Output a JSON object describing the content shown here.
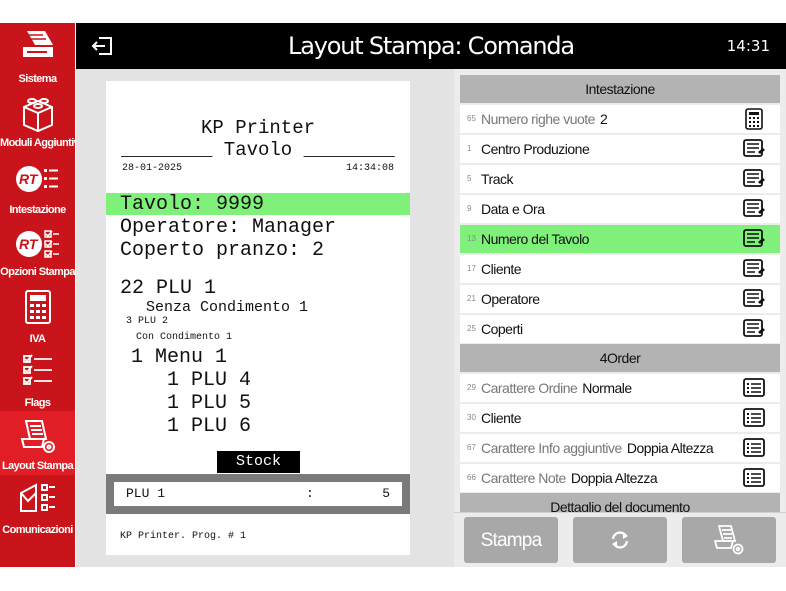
{
  "sidebar": {
    "items": [
      {
        "label": "Sistema",
        "icon": "printer-icon"
      },
      {
        "label": "Moduli Aggiuntivi",
        "icon": "blocks-icon"
      },
      {
        "label": "Intestazione",
        "icon": "rt-header-icon"
      },
      {
        "label": "Opzioni Stampa",
        "icon": "rt-options-icon"
      },
      {
        "label": "IVA",
        "icon": "calculator-icon"
      },
      {
        "label": "Flags",
        "icon": "checklist-icon"
      },
      {
        "label": "Layout Stampa",
        "icon": "layout-print-icon"
      },
      {
        "label": "Comunicazioni",
        "icon": "envelope-icon"
      }
    ],
    "active_index": 6
  },
  "header": {
    "title": "Layout Stampa: Comanda",
    "clock": "14:31",
    "back_icon": "exit-icon"
  },
  "receipt": {
    "printer_name": "KP Printer",
    "table_line": "________ Tavolo ________",
    "date": "28-01-2025",
    "time": "14:34:08",
    "tavolo": "Tavolo: 9999",
    "operatore": "Operatore: Manager",
    "coperto": "Coperto pranzo: 2",
    "item1": "22 PLU 1",
    "item1_note": "Senza Condimento 1",
    "item2": "3 PLU 2",
    "item2_note": "Con Condimento 1",
    "menu": "1 Menu 1",
    "menu_items": [
      "1 PLU 4",
      "1 PLU 5",
      "1 PLU 6"
    ],
    "stock_label": "Stock",
    "stock_plu": "PLU 1",
    "stock_sep": ":",
    "stock_qty": "5",
    "footer": "KP Printer. Prog. # 1"
  },
  "list": {
    "section1": "Intestazione",
    "section1_rows": [
      {
        "num": "65",
        "label": "Numero righe vuote",
        "value": "2",
        "dim": true,
        "icon": "calculator-icon"
      },
      {
        "num": "1",
        "label": "Centro Produzione",
        "value": "",
        "dim": false,
        "icon": "edit-list-icon"
      },
      {
        "num": "5",
        "label": "Track",
        "value": "",
        "dim": false,
        "icon": "edit-list-icon"
      },
      {
        "num": "9",
        "label": "Data e Ora",
        "value": "",
        "dim": false,
        "icon": "edit-list-icon"
      },
      {
        "num": "13",
        "label": "Numero del Tavolo",
        "value": "",
        "dim": false,
        "icon": "edit-list-icon"
      },
      {
        "num": "17",
        "label": "Cliente",
        "value": "",
        "dim": false,
        "icon": "edit-list-icon"
      },
      {
        "num": "21",
        "label": "Operatore",
        "value": "",
        "dim": false,
        "icon": "edit-list-icon"
      },
      {
        "num": "25",
        "label": "Coperti",
        "value": "",
        "dim": false,
        "icon": "edit-list-icon"
      }
    ],
    "highlight_index": 4,
    "section2": "4Order",
    "section2_rows": [
      {
        "num": "29",
        "label": "Carattere Ordine",
        "value": "Normale",
        "dim": true,
        "icon": "list-icon"
      },
      {
        "num": "30",
        "label": "Cliente",
        "value": "",
        "dim": false,
        "icon": "list-icon"
      },
      {
        "num": "67",
        "label": "Carattere Info aggiuntive",
        "value": "Doppia Altezza",
        "dim": true,
        "icon": "list-icon"
      },
      {
        "num": "66",
        "label": "Carattere Note",
        "value": "Doppia Altezza",
        "dim": true,
        "icon": "list-icon"
      }
    ],
    "section3": "Dettaglio del documento"
  },
  "buttons": {
    "stampa": "Stampa",
    "refresh_icon": "refresh-icon",
    "settings_icon": "print-settings-icon"
  },
  "colors": {
    "sidebar_red": "#c8141a",
    "highlight_green": "#7ff07a",
    "button_grey": "#a8a8a8"
  }
}
